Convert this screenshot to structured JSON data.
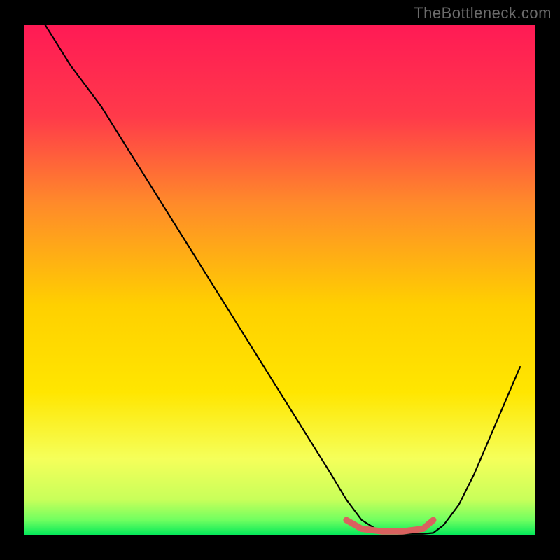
{
  "watermark": "TheBottleneck.com",
  "chart_data": {
    "type": "line",
    "title": "",
    "xlabel": "",
    "ylabel": "",
    "xlim": [
      0,
      100
    ],
    "ylim": [
      0,
      100
    ],
    "series": [
      {
        "name": "bottleneck-curve",
        "x": [
          4,
          9,
          15,
          20,
          25,
          30,
          35,
          40,
          45,
          50,
          55,
          60,
          63,
          66,
          70,
          74,
          78,
          80,
          82,
          85,
          88,
          91,
          94,
          97
        ],
        "y": [
          100,
          92,
          84,
          76,
          68,
          60,
          52,
          44,
          36,
          28,
          20,
          12,
          7,
          3,
          0.5,
          0.3,
          0.3,
          0.5,
          2,
          6,
          12,
          19,
          26,
          33
        ]
      },
      {
        "name": "optimal-range-marker",
        "x": [
          63,
          66,
          70,
          74,
          78,
          80
        ],
        "y": [
          3,
          1.3,
          0.8,
          0.8,
          1.3,
          3
        ]
      }
    ],
    "background_gradient": {
      "top": "#ff1a55",
      "upper_mid": "#ff8a2a",
      "mid": "#ffe600",
      "lower_mid": "#f8ff4a",
      "bottom": "#00ff66"
    },
    "annotations": []
  }
}
